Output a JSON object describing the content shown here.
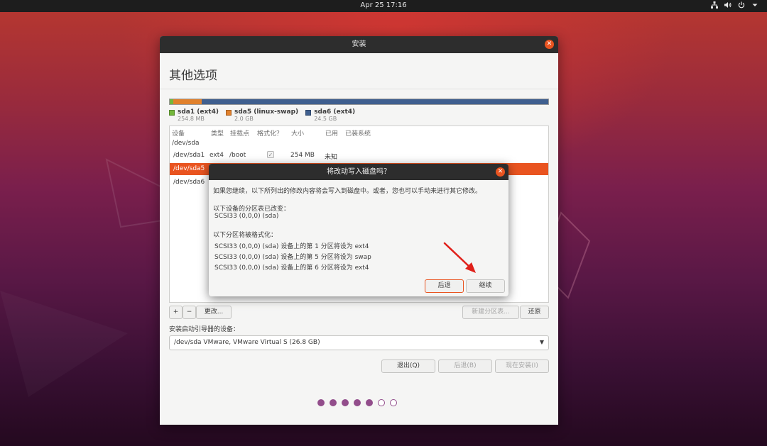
{
  "topbar": {
    "clock": "Apr 25  17:16",
    "icons": [
      "network-icon",
      "volume-icon",
      "power-icon",
      "menu-arrow-icon"
    ]
  },
  "window": {
    "title": "安装",
    "page_title": "其他选项",
    "partitions_legend": [
      {
        "name": "sda1 (ext4)",
        "size": "254.8 MB",
        "color": "#73b73b"
      },
      {
        "name": "sda5 (linux-swap)",
        "size": "2.0 GB",
        "color": "#e1812c"
      },
      {
        "name": "sda6 (ext4)",
        "size": "24.5 GB",
        "color": "#3f5f8f"
      }
    ],
    "partition_fractions": [
      0.0095,
      0.0745,
      0.916
    ],
    "table": {
      "headers": [
        "设备",
        "类型",
        "挂载点",
        "格式化？",
        "大小",
        "已用",
        "已装系统"
      ],
      "rows": [
        {
          "device": "/dev/sda"
        },
        {
          "device": "/dev/sda1",
          "type": "ext4",
          "mount": "/boot",
          "format": true,
          "size": "254 MB",
          "used": "未知"
        },
        {
          "device": "/dev/sda5"
        },
        {
          "device": "/dev/sda6"
        }
      ]
    },
    "toolbar": {
      "add": "+",
      "remove": "−",
      "change": "更改...",
      "new_table": "新建分区表...",
      "revert": "还原"
    },
    "boot_loader_label": "安装启动引导器的设备：",
    "boot_loader_value": "/dev/sda    VMware, VMware Virtual S (26.8 GB)",
    "buttons": {
      "quit": "退出(Q)",
      "back": "后退(B)",
      "install_now": "现在安装(I)"
    },
    "progress": {
      "total": 7,
      "completed": 5
    }
  },
  "dialog": {
    "title": "将改动写入磁盘吗？",
    "intro": "如果您继续，以下所列出的修改内容将会写入到磁盘中。或者，您也可以手动来进行其它修改。",
    "table_changed_heading": "以下设备的分区表已改变：",
    "table_changed_device": "SCSI33 (0,0,0) (sda)",
    "format_heading": "以下分区将被格式化：",
    "format_items": [
      "SCSI33 (0,0,0) (sda) 设备上的第 1 分区将设为 ext4",
      "SCSI33 (0,0,0) (sda) 设备上的第 5 分区将设为 swap",
      "SCSI33 (0,0,0) (sda) 设备上的第 6 分区将设为 ext4"
    ],
    "back_button": "后退",
    "continue_button": "继续"
  },
  "colors": {
    "accent": "#e95420",
    "titlebar": "#2d2d2d",
    "annotation_arrow": "#e0201a"
  }
}
